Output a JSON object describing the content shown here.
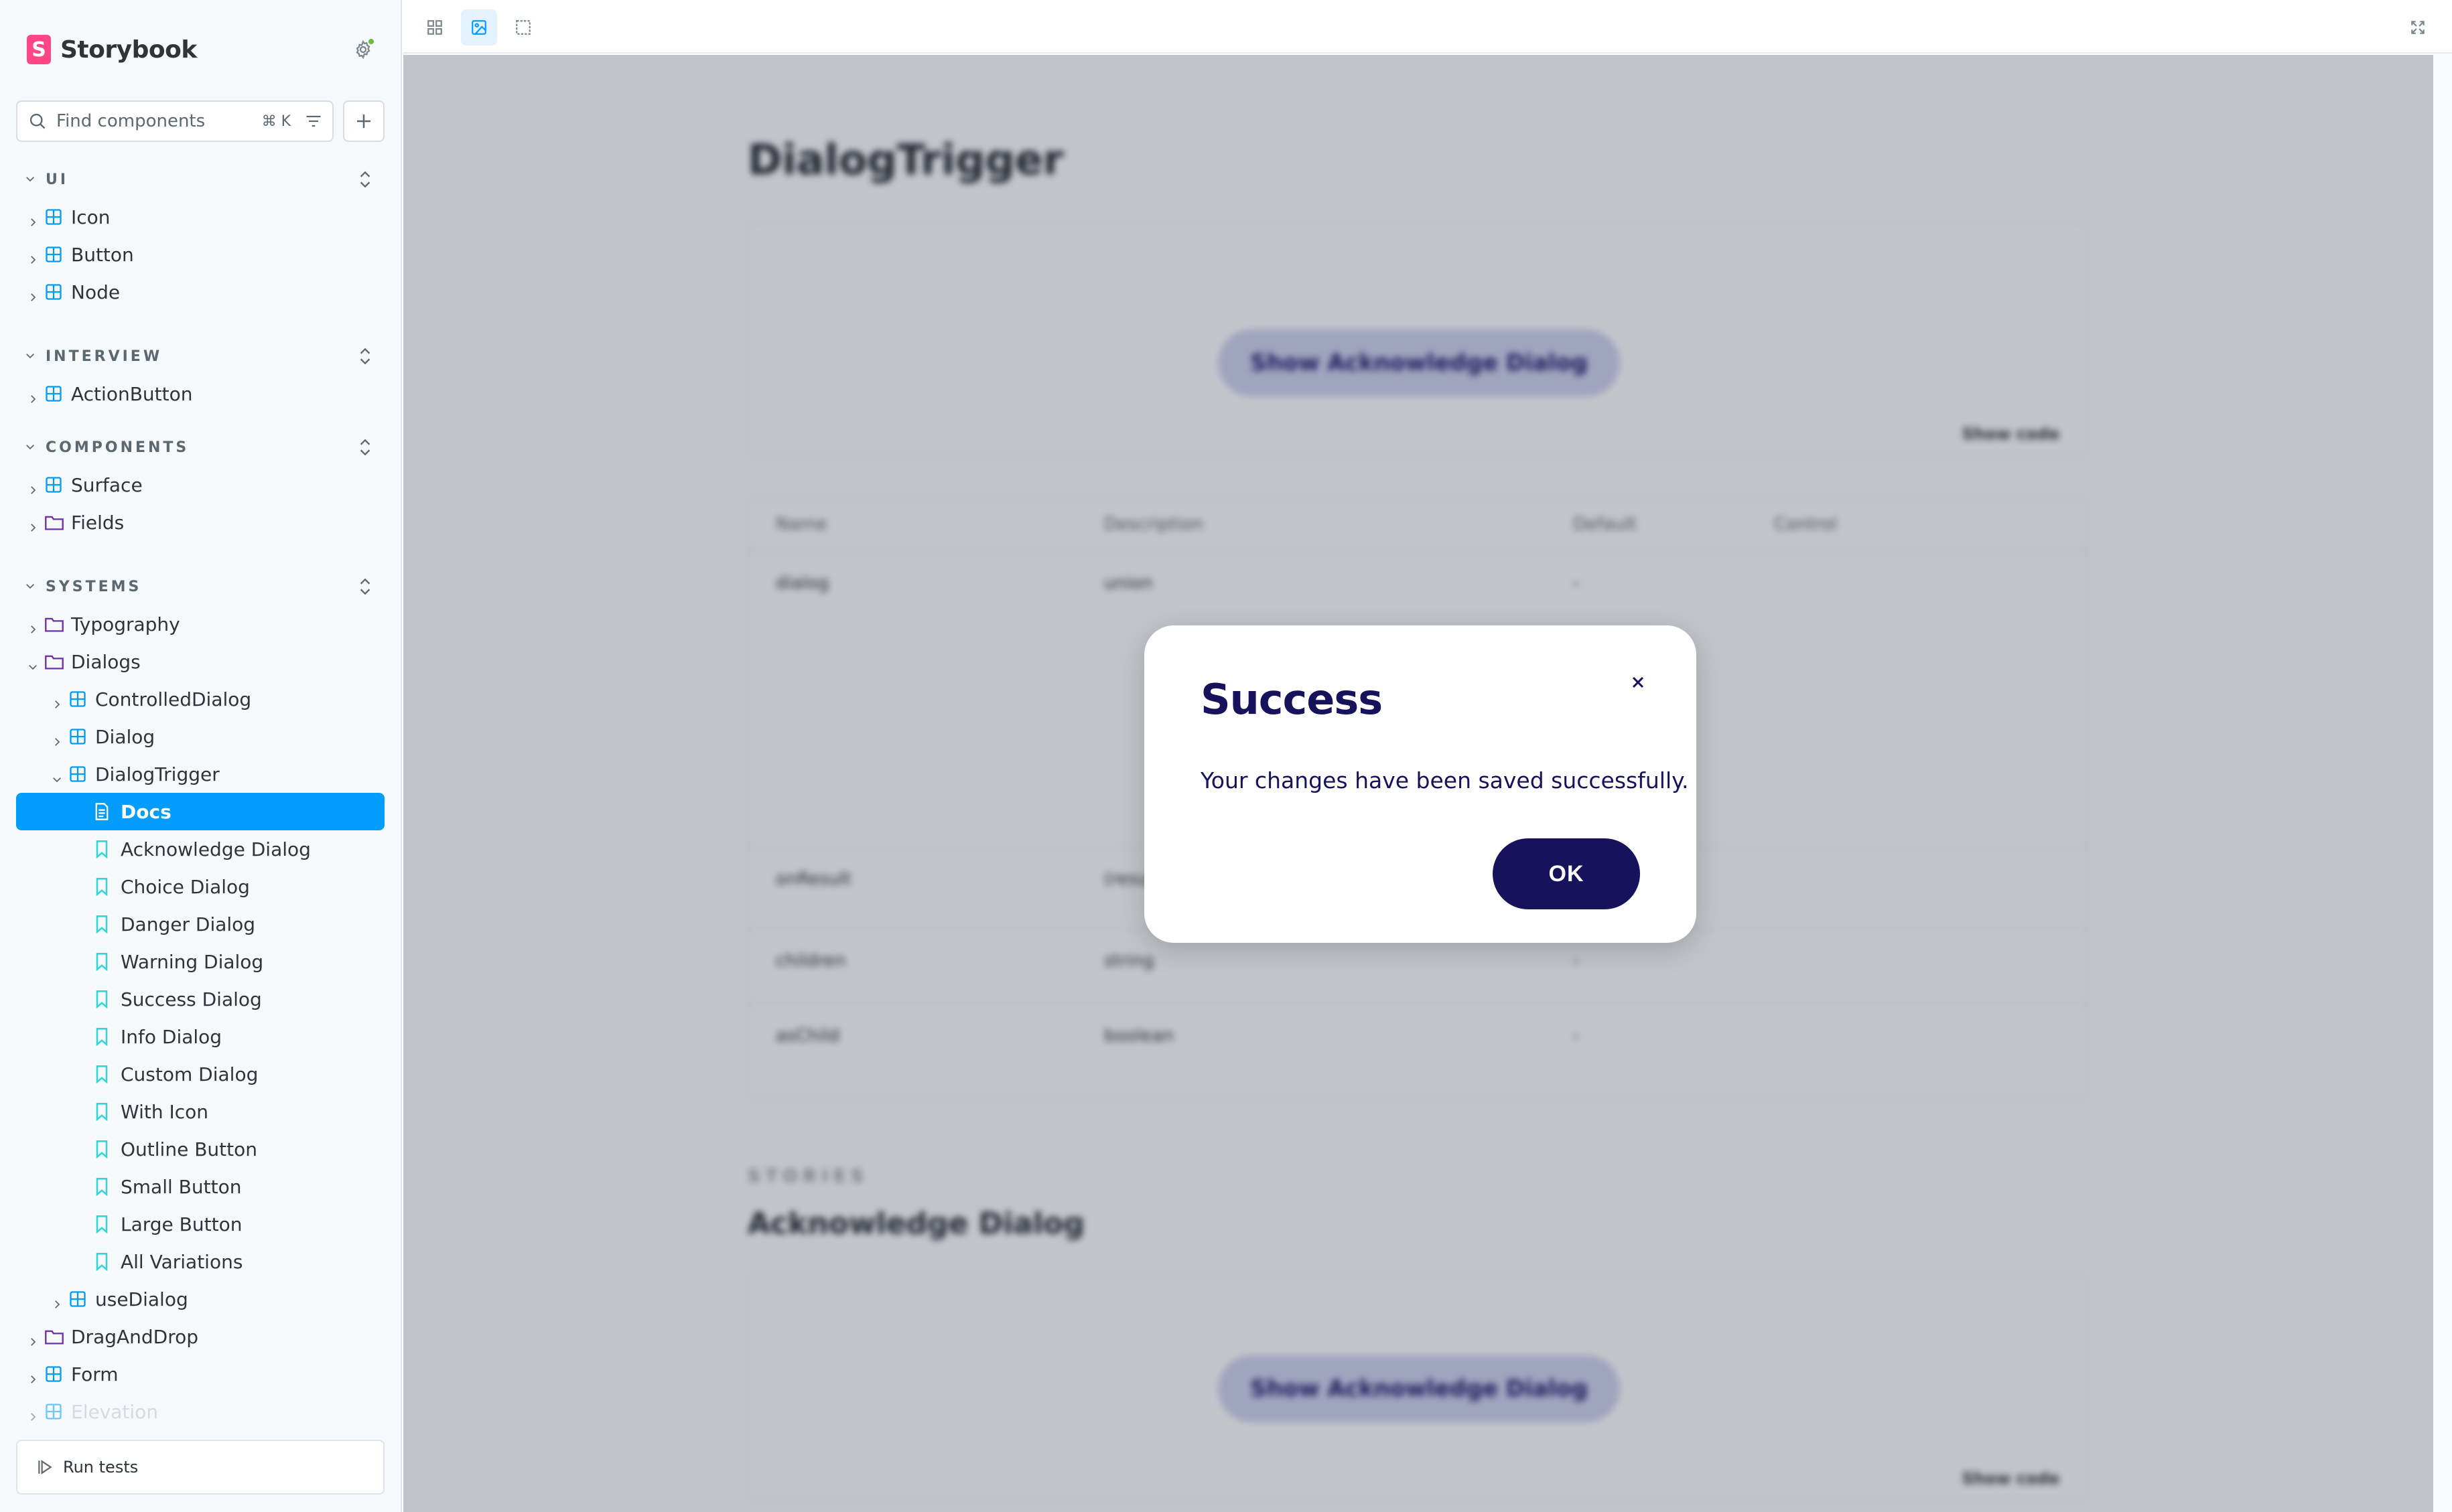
{
  "app": {
    "brand": "Storybook"
  },
  "sidebar": {
    "search_placeholder": "Find components",
    "search_shortcut": "⌘ K",
    "groups": [
      {
        "title": "UI",
        "items": [
          "Icon",
          "Button",
          "Node"
        ]
      },
      {
        "title": "INTERVIEW",
        "items": [
          "ActionButton"
        ]
      },
      {
        "title": "COMPONENTS",
        "items": [
          "Surface",
          "Fields"
        ]
      },
      {
        "title": "SYSTEMS",
        "items": [
          "Typography",
          "Dialogs"
        ]
      }
    ],
    "dialogs_children": [
      "ControlledDialog",
      "Dialog",
      "DialogTrigger"
    ],
    "dialogtrigger_children": [
      "Docs",
      "Acknowledge Dialog",
      "Choice Dialog",
      "Danger Dialog",
      "Warning Dialog",
      "Success Dialog",
      "Info Dialog",
      "Custom Dialog",
      "With Icon",
      "Outline Button",
      "Small Button",
      "Large Button",
      "All Variations"
    ],
    "after_dialogtrigger": [
      "useDialog"
    ],
    "systems_more": [
      "DragAndDrop",
      "Form",
      "Elevation"
    ],
    "run_tests_label": "Run tests"
  },
  "canvas": {
    "doc_title": "DialogTrigger",
    "preview_button": "Show Acknowledge Dialog",
    "show_code": "Show code",
    "table_headers": [
      "Name",
      "Description",
      "Default",
      "Control"
    ],
    "table_rows": [
      {
        "name": "dialog",
        "description": "union",
        "default": "-"
      },
      {
        "name": "onResult",
        "description": "(result: DialogResult) => void",
        "default": "-"
      },
      {
        "name": "children",
        "description": "string",
        "default": "-"
      },
      {
        "name": "asChild",
        "description": "boolean",
        "default": "-"
      }
    ],
    "stories_label": "STORIES",
    "story_title": "Acknowledge Dialog"
  },
  "dialog": {
    "title": "Success",
    "message": "Your changes have been saved successfully.",
    "ok_label": "OK"
  },
  "colors": {
    "accent": "#029cfd",
    "brand_pink": "#ff4785",
    "dialog_navy": "#16125c",
    "component_icon": "#029cfd",
    "story_icon": "#37d5d3",
    "folder_icon": "#6f2cac"
  }
}
